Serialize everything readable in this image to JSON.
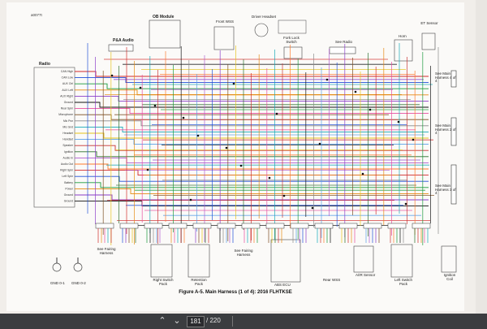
{
  "doc_id": "a0077t",
  "caption": "Figure A-5. Main Harness (1 of 4): 2016 FLHTKSE",
  "labels": {
    "radio": "Radio",
    "pa_audio": "P&A Audio",
    "ob_module": "OB Module",
    "front_wss": "Front WSS",
    "driver_headset": "Driver Headset",
    "fork_lock_switch": "Fork Lock Switch",
    "see_radio": "See Radio",
    "horn": "Horn",
    "et_sensor": "ET Sensor",
    "see_main_4of4": "See Main Harness 4 of 4",
    "see_main_2of4": "See Main Harness 2 of 4",
    "see_main_3of4": "See Main Harness 3 of 4",
    "see_fairing_1": "See Fairing Harness",
    "see_fairing_2": "See Fairing Harness",
    "right_switch_pack": "Right Switch Pack",
    "retention_pack": "Retention Pack",
    "left_switch_pack": "Left Switch Pack",
    "abs_ecu": "ABS ECU",
    "rear_wss": "Rear WSS",
    "air_sensor": "A/IR Sensor",
    "ignition_coil": "Ignition Coil",
    "gnd1": "GND 0-1",
    "gnd2": "GND 0-2"
  },
  "connectors": [
    "[280A]",
    "[70B]",
    "[220A]",
    "[164B]",
    "[167B]",
    "[307B]",
    "[51B]",
    "[218A]",
    "[135A]",
    "[120B]",
    "[122B]",
    "[105B]",
    "[22B]",
    "[205B]",
    "[27B]",
    "[258A]",
    "[149B]",
    "[1B]",
    "[116A]",
    "[134B]",
    "[4B]",
    "[139A]",
    "[108B]",
    "[120A]",
    "[135C]",
    "[90B]",
    "[42B]",
    "[78B]",
    "[77B]",
    "[18A]",
    "[30B]",
    "[GND0]"
  ],
  "radio_pins": [
    "CAN High",
    "CAN Low",
    "AUX Ctrl",
    "AUX Left",
    "AUX Right",
    "Ground",
    "Rear Spkr",
    "Microphone",
    "Mic Pwr",
    "Mic Gnd",
    "Headset",
    "Handset",
    "Speaker",
    "Ignition",
    "Audio In",
    "Audio Out",
    "Right Spkr",
    "Left Spkr",
    "Battery",
    "Power",
    "Ground",
    "Ground"
  ],
  "viewer": {
    "current_page": "181",
    "page_count": "/ 220",
    "prev_icon": "chevron-up-icon",
    "next_icon": "chevron-down-icon"
  }
}
